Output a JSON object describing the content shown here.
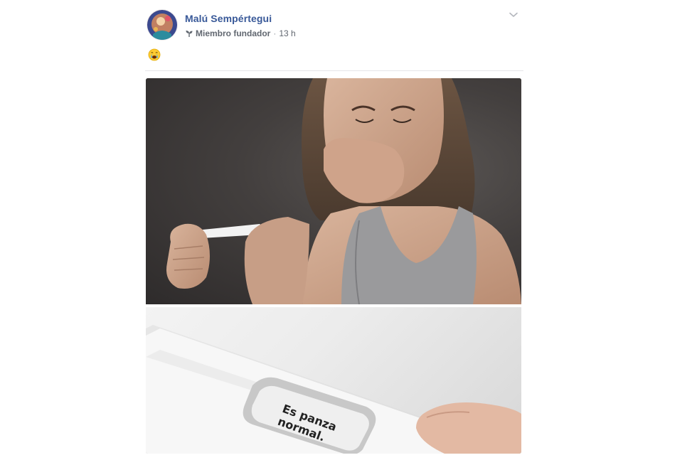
{
  "post": {
    "author": {
      "name": "Malú Sempértegui",
      "avatar_icon": "avatar"
    },
    "meta": {
      "badge_icon": "sprout-icon",
      "badge_label": "Miembro fundador",
      "separator": "·",
      "time": "13 h"
    },
    "options_icon": "chevron-down-icon",
    "text": {
      "emoji_icon": "crying-face-emoji"
    },
    "photo": {
      "caption_on_test": "Es panza\nnormal."
    }
  },
  "colors": {
    "author_link": "#385898",
    "meta_text": "#616770",
    "divider": "#e5e6e9"
  }
}
